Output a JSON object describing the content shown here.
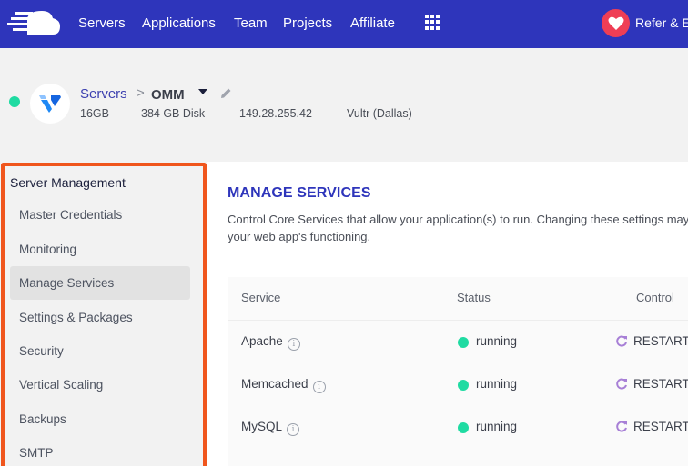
{
  "nav": {
    "items": [
      "Servers",
      "Applications",
      "Team",
      "Projects",
      "Affiliate"
    ],
    "refer_label": "Refer & Ea",
    "icons": {
      "logo": "cloudways-cloud-logo",
      "apps": "grid-icon",
      "refer": "heart-icon"
    }
  },
  "server": {
    "breadcrumb_root": "Servers",
    "breadcrumb_separator": ">",
    "name": "OMM",
    "ram": "16GB",
    "disk": "384 GB Disk",
    "ip": "149.28.255.42",
    "provider": "Vultr (Dallas)",
    "status_color": "#1fdba2"
  },
  "sidebar": {
    "title": "Server Management",
    "items": [
      {
        "label": "Master Credentials",
        "active": false
      },
      {
        "label": "Monitoring",
        "active": false
      },
      {
        "label": "Manage Services",
        "active": true
      },
      {
        "label": "Settings & Packages",
        "active": false
      },
      {
        "label": "Security",
        "active": false
      },
      {
        "label": "Vertical Scaling",
        "active": false
      },
      {
        "label": "Backups",
        "active": false
      },
      {
        "label": "SMTP",
        "active": false
      }
    ],
    "highlight_color": "#f0561d"
  },
  "main": {
    "title": "MANAGE SERVICES",
    "description": "Control Core Services that allow your application(s) to run. Changing these settings may affect your web app's functioning.",
    "table": {
      "headers": [
        "Service",
        "Status",
        "Control"
      ],
      "rows": [
        {
          "service": "Apache",
          "status": "running",
          "control": "RESTART"
        },
        {
          "service": "Memcached",
          "status": "running",
          "control": "RESTART"
        },
        {
          "service": "MySQL",
          "status": "running",
          "control": "RESTART"
        }
      ]
    }
  },
  "colors": {
    "brand": "#2e35bb",
    "running": "#1fdba2",
    "restart_icon": "#a77fd6"
  }
}
